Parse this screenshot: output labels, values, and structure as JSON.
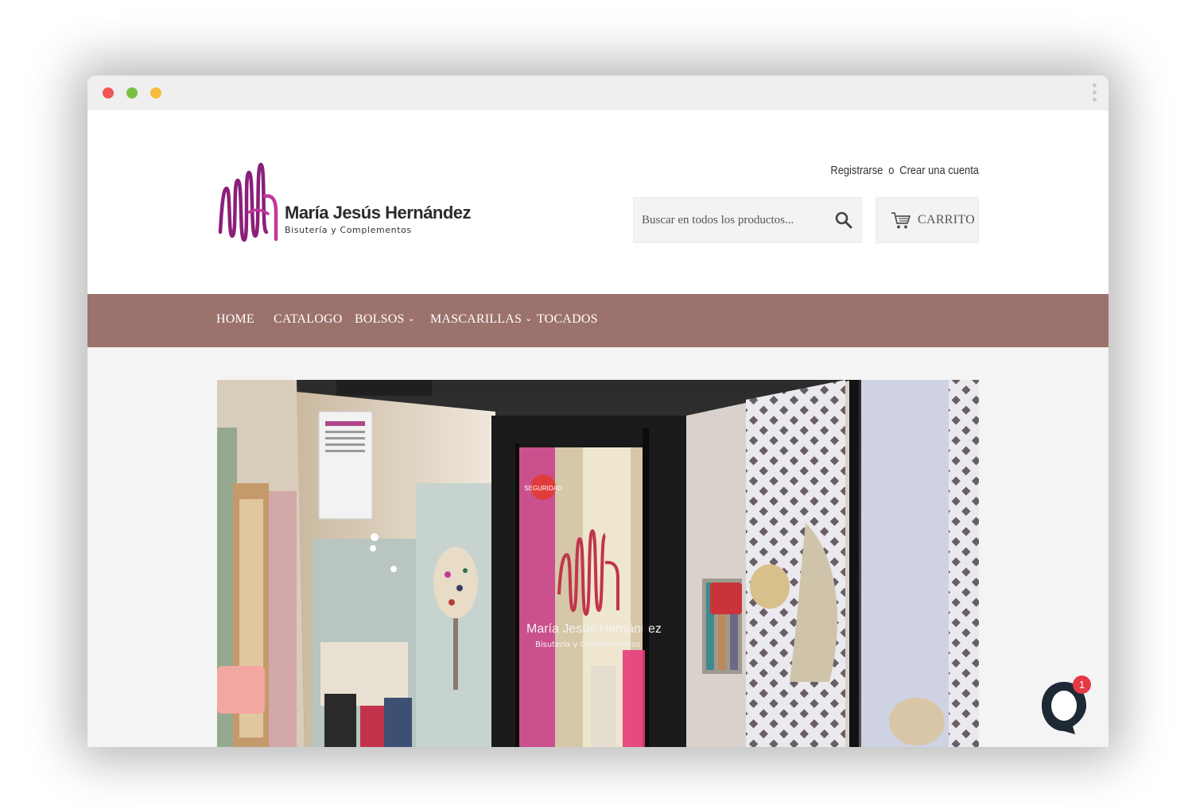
{
  "window": {
    "menu_icon": "kebab-icon"
  },
  "header": {
    "logo": {
      "name": "María Jesús Hernández",
      "subtitle": "Bisutería y Complementos"
    },
    "account": {
      "login": "Registrarse",
      "separator": "o",
      "register": "Crear una cuenta"
    },
    "search": {
      "placeholder": "Buscar en todos los productos...",
      "icon": "search-icon"
    },
    "cart": {
      "label": "CARRITO",
      "icon": "cart-icon"
    }
  },
  "nav": {
    "items": [
      {
        "label": "HOME",
        "has_dropdown": false
      },
      {
        "label": "CATALOGO",
        "has_dropdown": false
      },
      {
        "label": "BOLSOS",
        "has_dropdown": true
      },
      {
        "label": "MASCARILLAS",
        "has_dropdown": true
      },
      {
        "label": "TOCADOS",
        "has_dropdown": false
      }
    ],
    "background": "#9c726c"
  },
  "hero": {
    "storefront_sign": {
      "name": "María Jesús Hernández",
      "subtitle": "Bisutería y Complementos"
    }
  },
  "chat": {
    "badge_count": "1",
    "icon": "chat-icon"
  },
  "colors": {
    "brand_purple": "#7a1f6e",
    "brand_magenta": "#b02a8f",
    "nav": "#9c726c",
    "badge": "#e63946"
  }
}
